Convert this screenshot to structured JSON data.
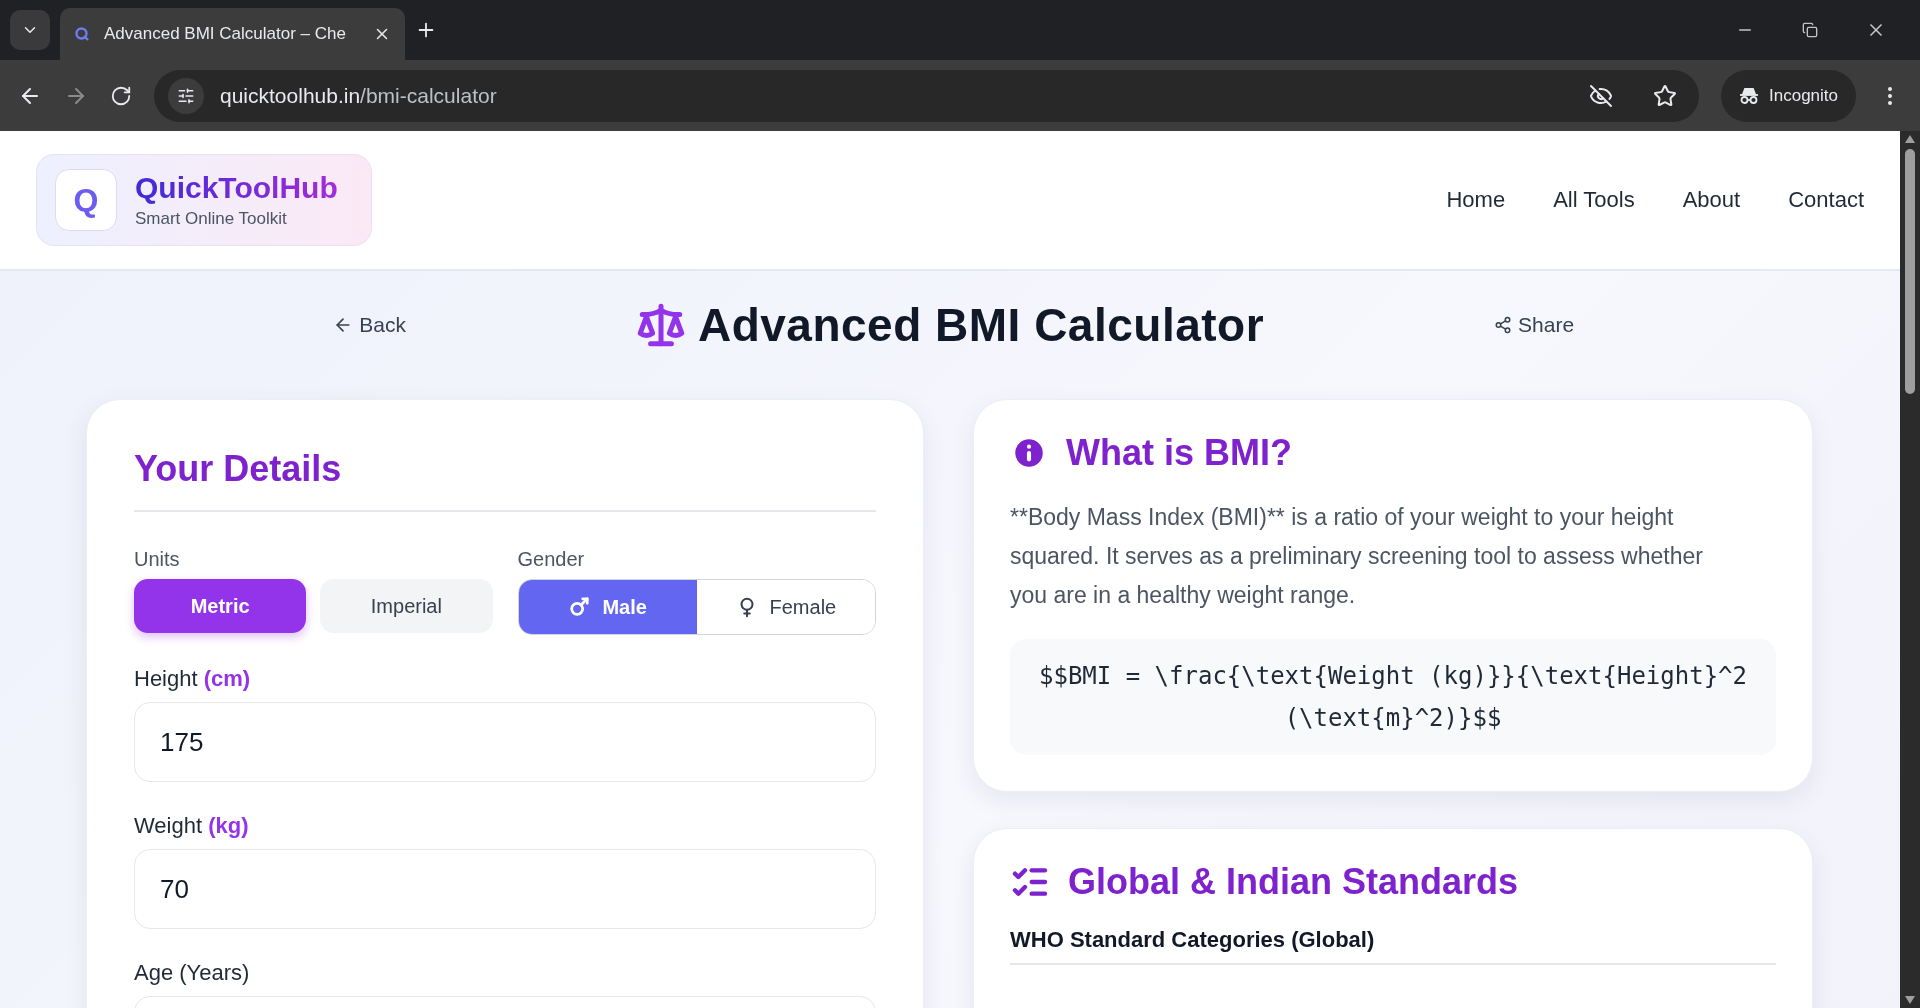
{
  "browser": {
    "tab_title": "Advanced BMI Calculator – Che",
    "url_host": "quicktoolhub.in",
    "url_path": "/bmi-calculator",
    "profile_label": "Incognito"
  },
  "header": {
    "logo_letter": "Q",
    "brand": "QuickToolHub",
    "tagline": "Smart Online Toolkit",
    "nav": [
      "Home",
      "All Tools",
      "About",
      "Contact"
    ]
  },
  "title_bar": {
    "back": "Back",
    "title": "Advanced BMI Calculator",
    "share": "Share"
  },
  "details": {
    "title": "Your Details",
    "units_label": "Units",
    "units": [
      {
        "label": "Metric",
        "selected": true
      },
      {
        "label": "Imperial",
        "selected": false
      }
    ],
    "gender_label": "Gender",
    "genders": [
      {
        "label": "Male",
        "kind": "male",
        "selected": true
      },
      {
        "label": "Female",
        "kind": "female",
        "selected": false
      }
    ],
    "fields": [
      {
        "label": "Height",
        "unit": "(cm)",
        "value": "175"
      },
      {
        "label": "Weight",
        "unit": "(kg)",
        "value": "70"
      },
      {
        "label": "Age (Years)"
      }
    ]
  },
  "info": {
    "title": "What is BMI?",
    "text": "**Body Mass Index (BMI)** is a ratio of your weight to your height squared. It serves as a preliminary screening tool to assess whether you are in a healthy weight range.",
    "formula": "$$BMI = \\frac{\\text{Weight (kg)}}{\\text{Height}^2 (\\text{m}^2)}$$"
  },
  "standards": {
    "title": "Global & Indian Standards",
    "subtitle": "WHO Standard Categories (Global)"
  }
}
